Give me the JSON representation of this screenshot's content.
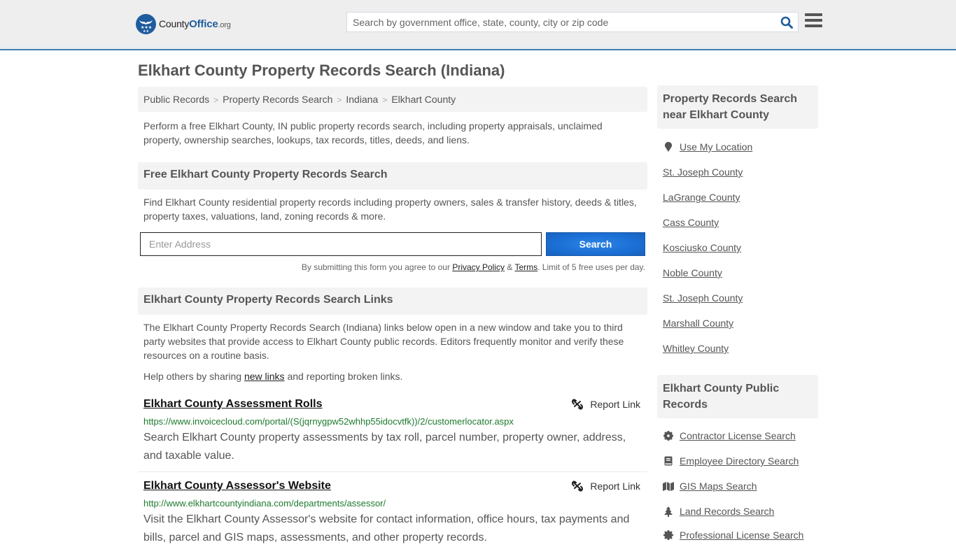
{
  "header": {
    "logo": {
      "prefix": "County",
      "brand": "Office",
      "suffix": ".org"
    },
    "search_placeholder": "Search by government office, state, county, city or zip code"
  },
  "page": {
    "title": "Elkhart County Property Records Search (Indiana)",
    "breadcrumb": [
      "Public Records",
      "Property Records Search",
      "Indiana",
      "Elkhart County"
    ],
    "intro": "Perform a free Elkhart County, IN public property records search, including property appraisals, unclaimed property, ownership searches, lookups, tax records, titles, deeds, and liens."
  },
  "free_search": {
    "heading": "Free Elkhart County Property Records Search",
    "description": "Find Elkhart County residential property records including property owners, sales & transfer history, deeds & titles, property taxes, valuations, land, zoning records & more.",
    "address_placeholder": "Enter Address",
    "button_label": "Search",
    "disclaimer_prefix": "By submitting this form you agree to our ",
    "privacy_label": "Privacy Policy",
    "amp": " & ",
    "terms_label": "Terms",
    "disclaimer_suffix": ". Limit of 5 free uses per day."
  },
  "links_section": {
    "heading": "Elkhart County Property Records Search Links",
    "description": "The Elkhart County Property Records Search (Indiana) links below open in a new window and take you to third party websites that provide access to Elkhart County public records. Editors frequently monitor and verify these resources on a routine basis.",
    "help_prefix": "Help others by sharing ",
    "help_link": "new links",
    "help_suffix": " and reporting broken links.",
    "report_label": "Report Link",
    "items": [
      {
        "title": "Elkhart County Assessment Rolls",
        "url": "https://www.invoicecloud.com/portal/(S(jqrnygpw52whhp55idocvtfk))/2/customerlocator.aspx",
        "description": "Search Elkhart County property assessments by tax roll, parcel number, property owner, address, and taxable value."
      },
      {
        "title": "Elkhart County Assessor's Website",
        "url": "http://www.elkhartcountyindiana.com/departments/assessor/",
        "description": "Visit the Elkhart County Assessor's website for contact information, office hours, tax payments and bills, parcel and GIS maps, assessments, and other property records."
      }
    ]
  },
  "sidebar": {
    "nearby": {
      "heading": "Property Records Search near Elkhart County",
      "use_location": "Use My Location",
      "counties": [
        "St. Joseph County",
        "LaGrange County",
        "Cass County",
        "Kosciusko County",
        "Noble County",
        "St. Joseph County",
        "Marshall County",
        "Whitley County"
      ]
    },
    "public_records": {
      "heading": "Elkhart County Public Records",
      "items": [
        {
          "label": "Contractor License Search",
          "icon": "gear-icon"
        },
        {
          "label": "Employee Directory Search",
          "icon": "book-icon"
        },
        {
          "label": "GIS Maps Search",
          "icon": "map-icon"
        },
        {
          "label": "Land Records Search",
          "icon": "tree-icon"
        },
        {
          "label": "Professional License Search",
          "icon": "badge-icon"
        }
      ]
    }
  },
  "colors": {
    "brand_blue": "#1f5c9e",
    "header_border": "#3d7fb5",
    "button_blue": "#1b6fd4",
    "url_green": "#1e7a2e"
  }
}
